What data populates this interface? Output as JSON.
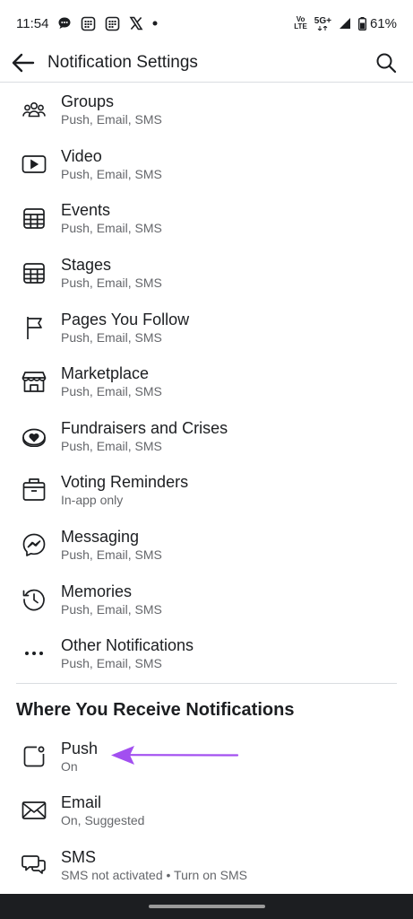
{
  "status": {
    "time": "11:54",
    "net_volte_top": "Vo",
    "net_volte_bottom": "LTE",
    "net_5g": "5G+",
    "battery": "61%"
  },
  "header": {
    "title": "Notification Settings"
  },
  "items": [
    {
      "title": "Groups",
      "sub": "Push, Email, SMS",
      "icon": "groups-icon"
    },
    {
      "title": "Video",
      "sub": "Push, Email, SMS",
      "icon": "video-icon"
    },
    {
      "title": "Events",
      "sub": "Push, Email, SMS",
      "icon": "events-icon"
    },
    {
      "title": "Stages",
      "sub": "Push, Email, SMS",
      "icon": "stages-icon"
    },
    {
      "title": "Pages You Follow",
      "sub": "Push, Email, SMS",
      "icon": "flag-icon"
    },
    {
      "title": "Marketplace",
      "sub": "Push, Email, SMS",
      "icon": "marketplace-icon"
    },
    {
      "title": "Fundraisers and Crises",
      "sub": "Push, Email, SMS",
      "icon": "fundraiser-icon"
    },
    {
      "title": "Voting Reminders",
      "sub": "In-app only",
      "icon": "ballot-box-icon"
    },
    {
      "title": "Messaging",
      "sub": "Push, Email, SMS",
      "icon": "messenger-icon"
    },
    {
      "title": "Memories",
      "sub": "Push, Email, SMS",
      "icon": "memories-icon"
    },
    {
      "title": "Other Notifications",
      "sub": "Push, Email, SMS",
      "icon": "more-dots-icon"
    }
  ],
  "section": {
    "title": "Where You Receive Notifications"
  },
  "channels": [
    {
      "title": "Push",
      "sub": "On",
      "icon": "push-icon"
    },
    {
      "title": "Email",
      "sub": "On, Suggested",
      "icon": "email-icon"
    },
    {
      "title": "SMS",
      "sub": "SMS not activated • Turn on SMS",
      "icon": "sms-icon"
    }
  ],
  "colors": {
    "arrow": "#a24ff0",
    "subtext": "#65676b",
    "divider": "#dadde1"
  }
}
